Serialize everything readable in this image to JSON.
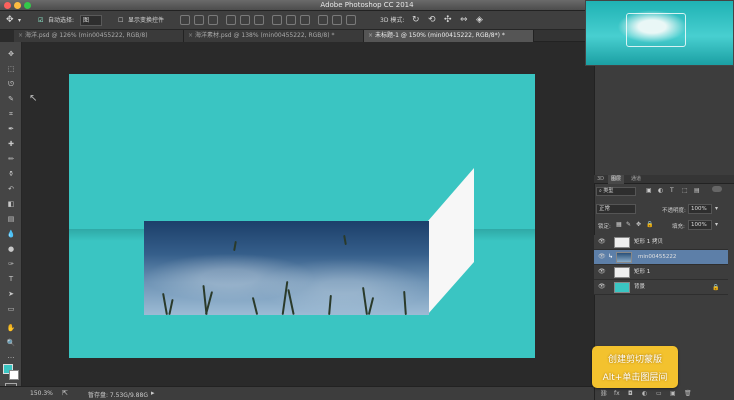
{
  "window": {
    "title": "Adobe Photoshop CC 2014"
  },
  "options_bar": {
    "auto_select_label": "自动选择:",
    "auto_select_value": "图",
    "show_transform_label": "显示变换控件",
    "mode_3d_label": "3D 模式:"
  },
  "tabs": [
    {
      "label": "海洋.psd @ 126% (min00455222, RGB/8)"
    },
    {
      "label": "海洋素材.psd @ 138% (min00455222, RGB/8) *"
    },
    {
      "label": "未标题-1 @ 150% (min00415222, RGB/8*) *"
    }
  ],
  "status": {
    "zoom": "150.3%",
    "doc_info": "暂存盘: 7.53G/9.88G"
  },
  "panel": {
    "tabs": [
      "3D",
      "图层",
      "通道"
    ],
    "kind_label": "类型",
    "blend_mode": "正常",
    "opacity_label": "不透明度:",
    "opacity_value": "100%",
    "lock_label": "锁定:",
    "fill_label": "填充:",
    "fill_value": "100%",
    "layers": [
      {
        "name": "矩形 1 拷贝",
        "selected": false
      },
      {
        "name": "min00455222",
        "selected": true
      },
      {
        "name": "矩形 1",
        "selected": false
      },
      {
        "name": "背景",
        "selected": false
      }
    ]
  },
  "tooltip": {
    "line1": "创建剪切蒙版",
    "line2": "Alt+单击图层间"
  },
  "colors": {
    "canvas": "#3ac5c2",
    "selected_layer": "#5d7fa8",
    "tooltip_bg": "#f3c22e"
  }
}
